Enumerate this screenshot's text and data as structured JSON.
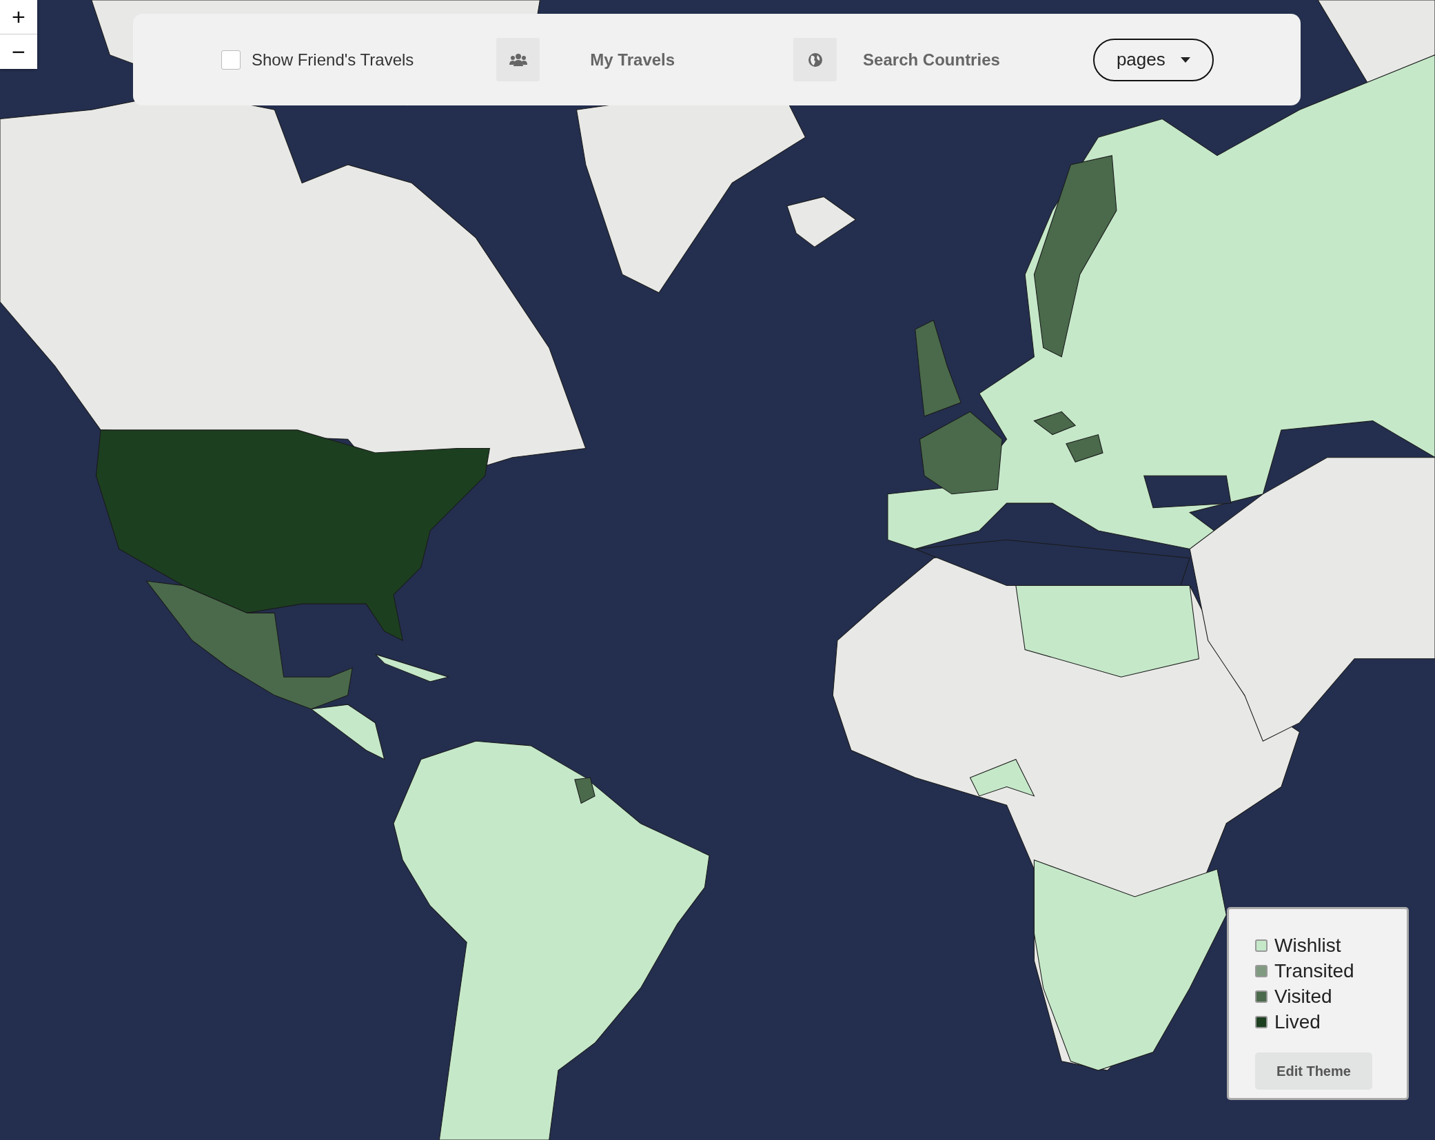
{
  "zoom_controls": [
    {
      "label": "+"
    },
    {
      "label": "−"
    }
  ],
  "toolbar": {
    "show_friends": {
      "label": "Show Friend's Travels",
      "checked": false
    },
    "my_travels": {
      "label": "My Travels"
    },
    "search": {
      "label": "Search Countries"
    },
    "pages_dropdown": {
      "label": "pages"
    }
  },
  "legend": {
    "items": [
      {
        "label": "Wishlist",
        "color": "#c5e8c9"
      },
      {
        "label": "Transited",
        "color": "#7f9a80"
      },
      {
        "label": "Visited",
        "color": "#4a6a4b"
      },
      {
        "label": "Lived",
        "color": "#1c3f20"
      }
    ],
    "button": "Edit Theme"
  }
}
